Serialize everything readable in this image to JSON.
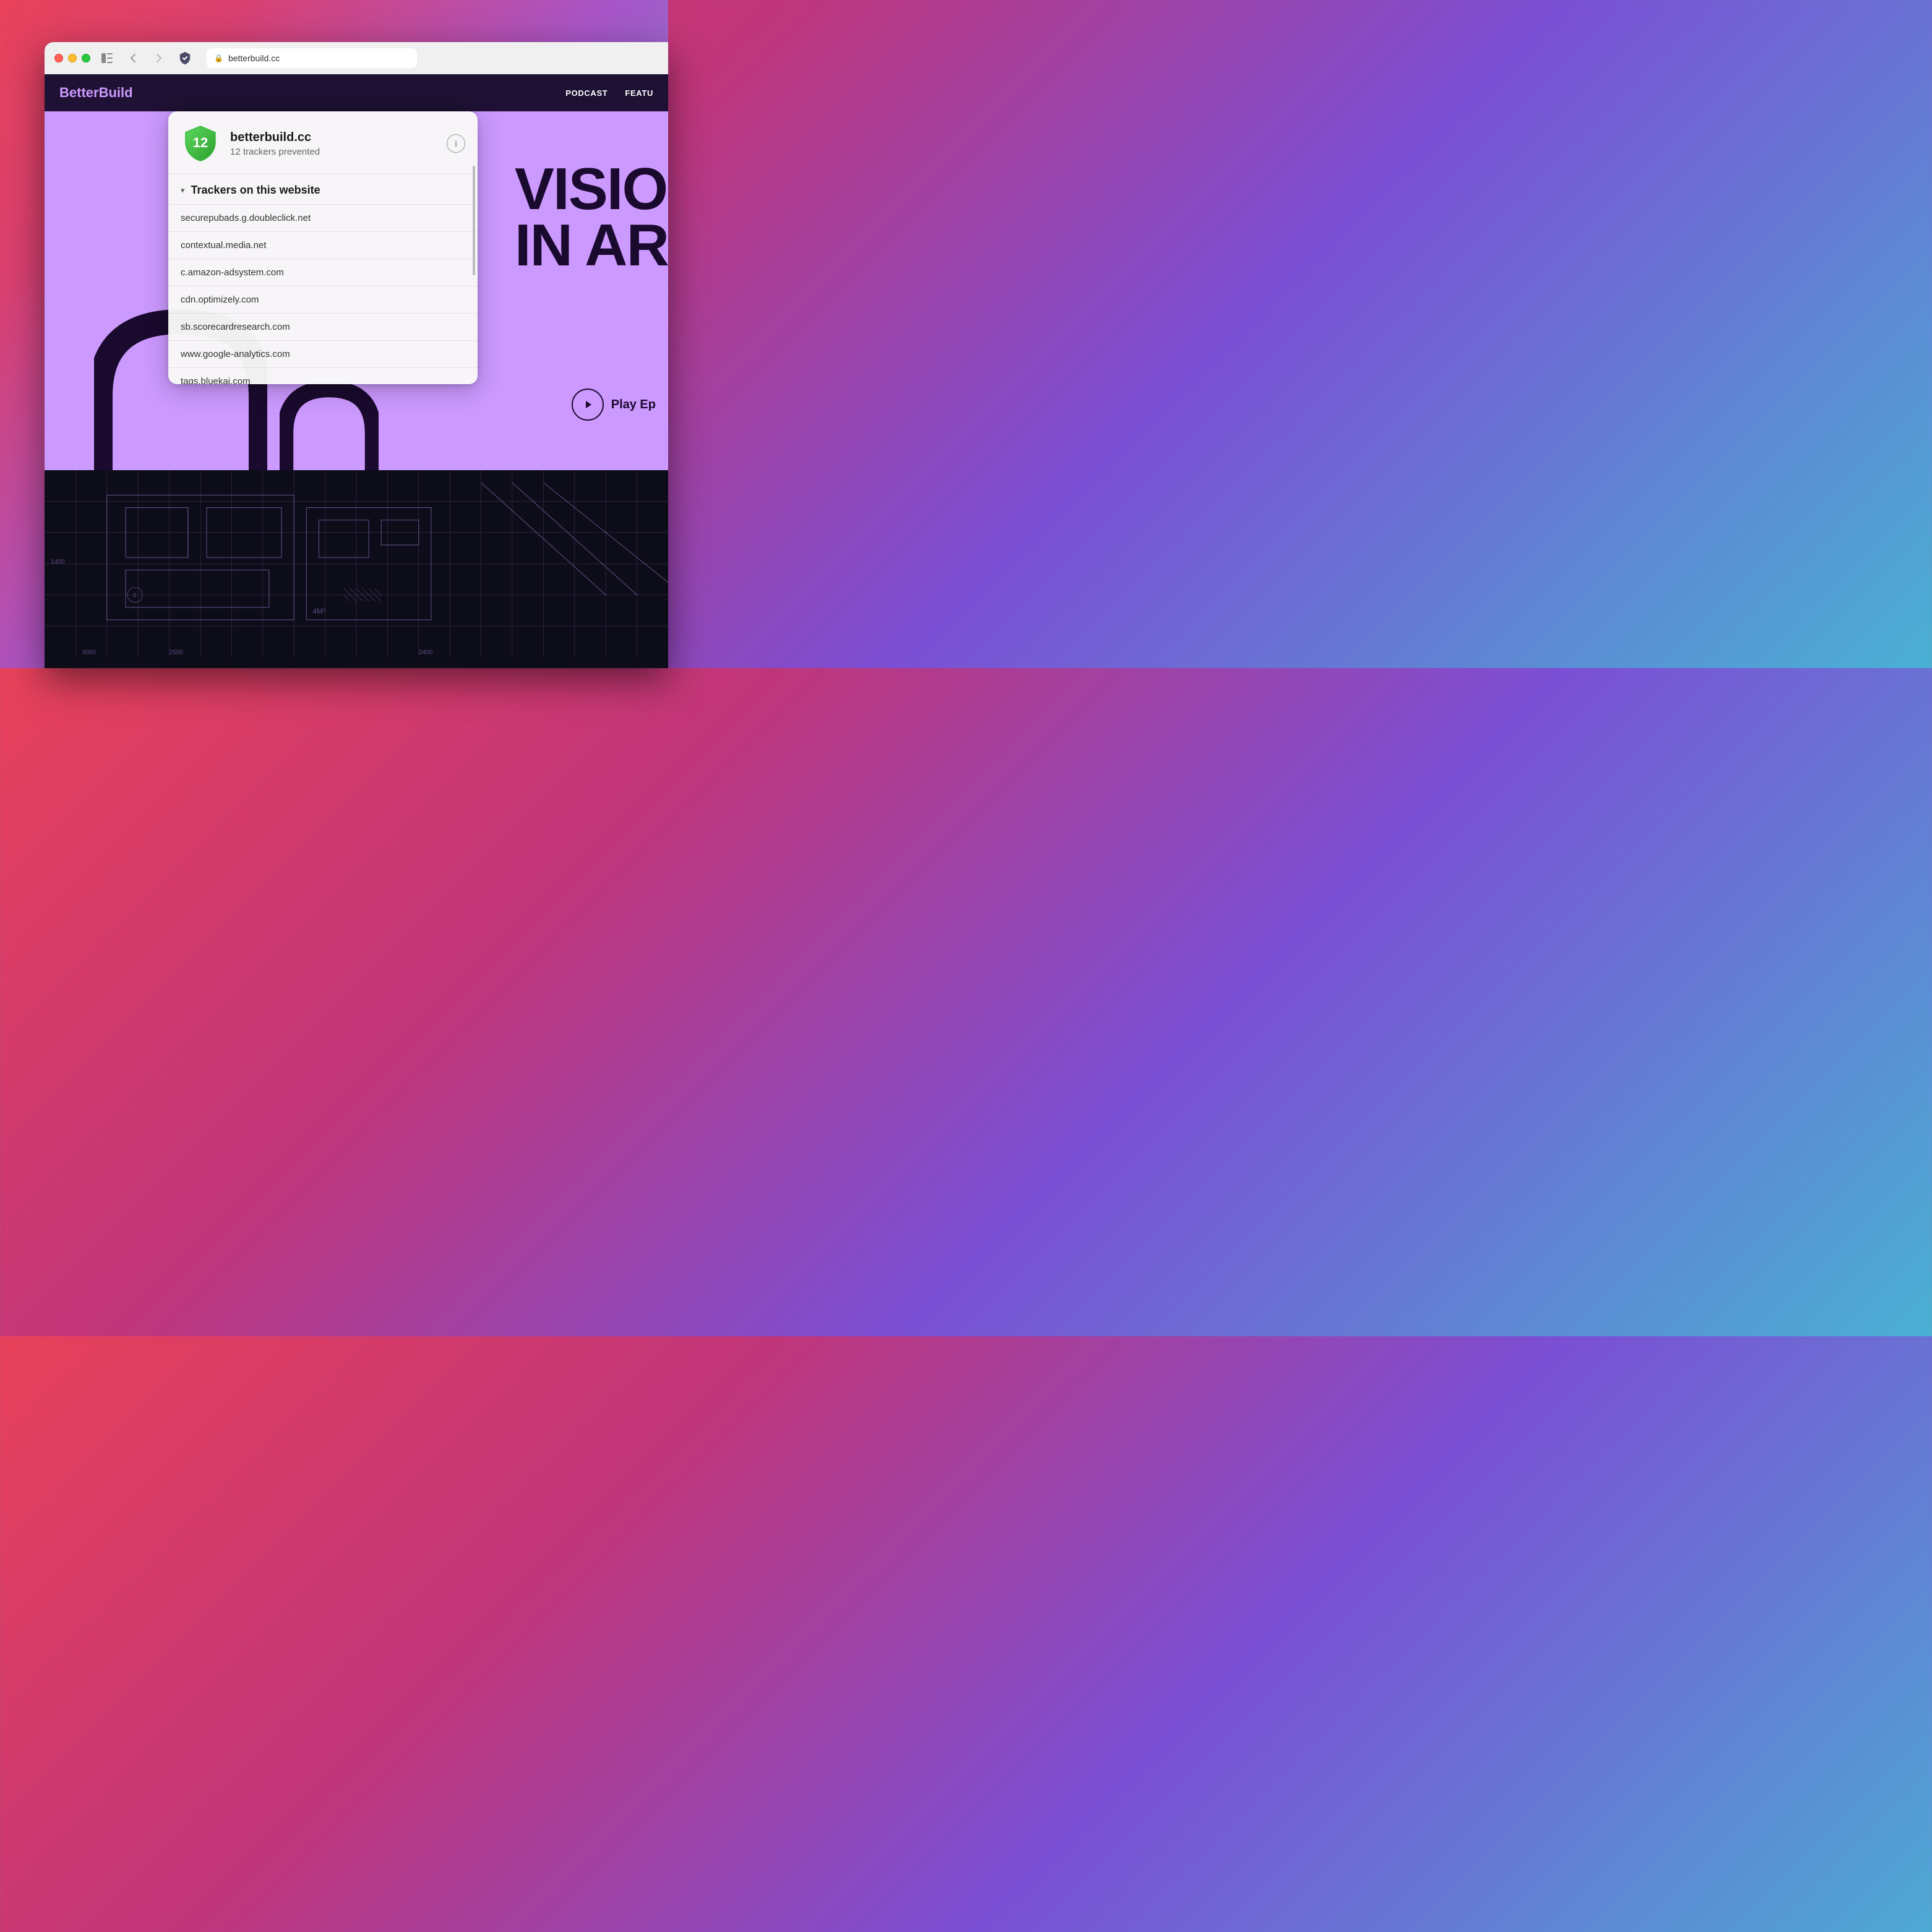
{
  "desktop": {
    "bg_note": "gradient from pink-red to blue"
  },
  "window": {
    "title": "betterbuild.cc",
    "url": "betterbuild.cc",
    "traffic_lights": {
      "red": "close",
      "yellow": "minimize",
      "green": "maximize"
    }
  },
  "website": {
    "logo_text_dark": "BetterBu",
    "logo_text_light": "ild",
    "nav_items": [
      "PODCAST",
      "FEATU"
    ],
    "hero_text_line1": "VISIO",
    "hero_text_line2": "IN AR",
    "play_label": "Play Ep"
  },
  "popup": {
    "site_name": "betterbuild.cc",
    "trackers_prevented_count": "12",
    "trackers_prevented_label": "12 trackers prevented",
    "section_title": "Trackers on this website",
    "info_icon_label": "ⓘ",
    "tracker_items": [
      "securepubads.g.doubleclick.net",
      "contextual.media.net",
      "c.amazon-adsystem.com",
      "cdn.optimizely.com",
      "sb.scorecardresearch.com",
      "www.google-analytics.com",
      "tags.bluekai.com"
    ],
    "shield_number": "12"
  }
}
